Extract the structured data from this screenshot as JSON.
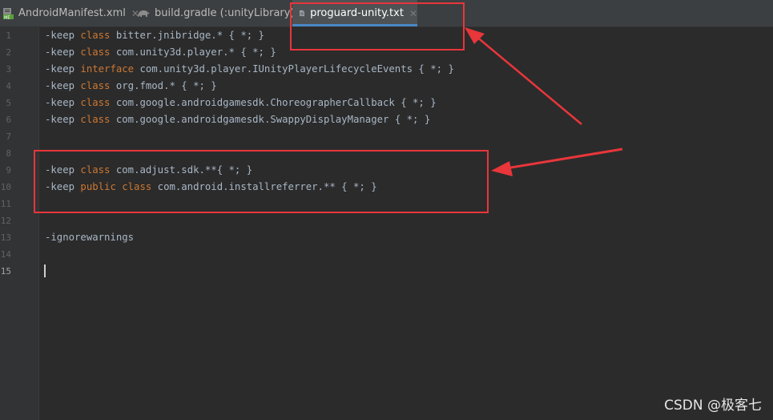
{
  "tabs": [
    {
      "label": "AndroidManifest.xml",
      "icon": "xml-file-icon",
      "active": false
    },
    {
      "label": "build.gradle (:unityLibrary)",
      "icon": "gradle-icon",
      "active": false
    },
    {
      "label": "proguard-unity.txt",
      "icon": "text-file-icon",
      "active": true
    }
  ],
  "close_glyph": "✕",
  "editor": {
    "line_numbers": [
      "1",
      "2",
      "3",
      "4",
      "5",
      "6",
      "7",
      "8",
      "9",
      "10",
      "11",
      "12",
      "13",
      "14",
      "15"
    ],
    "current_line": "15",
    "lines": [
      {
        "prefix": "-keep ",
        "kw": "class",
        "rest": " bitter.jnibridge.* { *; }"
      },
      {
        "prefix": "-keep ",
        "kw": "class",
        "rest": " com.unity3d.player.* { *; }"
      },
      {
        "prefix": "-keep ",
        "kw": "interface",
        "rest": " com.unity3d.player.IUnityPlayerLifecycleEvents { *; }"
      },
      {
        "prefix": "-keep ",
        "kw": "class",
        "rest": " org.fmod.* { *; }"
      },
      {
        "prefix": "-keep ",
        "kw": "class",
        "rest": " com.google.androidgamesdk.ChoreographerCallback { *; }"
      },
      {
        "prefix": "-keep ",
        "kw": "class",
        "rest": " com.google.androidgamesdk.SwappyDisplayManager { *; }"
      },
      {
        "prefix": "",
        "kw": "",
        "rest": ""
      },
      {
        "prefix": "",
        "kw": "",
        "rest": ""
      },
      {
        "prefix": "-keep ",
        "kw": "class",
        "rest": " com.adjust.sdk.**{ *; }"
      },
      {
        "prefix": "-keep ",
        "kw": "public class",
        "rest": " com.android.installreferrer.** { *; }"
      },
      {
        "prefix": "",
        "kw": "",
        "rest": ""
      },
      {
        "prefix": "",
        "kw": "",
        "rest": ""
      },
      {
        "prefix": "-ignorewarnings",
        "kw": "",
        "rest": ""
      },
      {
        "prefix": "",
        "kw": "",
        "rest": ""
      },
      {
        "prefix": "",
        "kw": "",
        "rest": ""
      }
    ]
  },
  "colors": {
    "keyword": "#cc7832",
    "text": "#a9b7c6",
    "annotation": "#e8363b",
    "tab_underline": "#4a88c7"
  },
  "watermark": "CSDN @极客七"
}
